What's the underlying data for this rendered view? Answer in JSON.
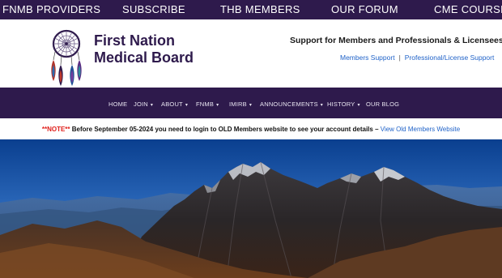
{
  "topbar": {
    "links": [
      "FNMB PROVIDERS",
      "SUBSCRIBE",
      "THB MEMBERS",
      "OUR FORUM",
      "CME COURSES"
    ]
  },
  "header": {
    "logo_line1": "First Nation",
    "logo_line2": "Medical Board",
    "support_title": "Support for Members and Professionals & Licensees",
    "members_support": "Members Support",
    "separator": "|",
    "professional_support": "Professional/License Support"
  },
  "nav": {
    "items": [
      {
        "label": "HOME"
      },
      {
        "label": "JOIN"
      },
      {
        "label": "ABOUT"
      },
      {
        "label": "FNMB"
      },
      {
        "label": "IMIRB"
      },
      {
        "label": "ANNOUNCEMENTS"
      },
      {
        "label": "HISTORY"
      },
      {
        "label": "OUR BLOG"
      }
    ],
    "caret": "▾"
  },
  "notice": {
    "note": "**NOTE**",
    "text": " Before September 05-2024 you need to login to OLD Members website to see your account details – ",
    "link": "View Old Members Website"
  },
  "colors": {
    "brand_purple": "#2e1a4c",
    "link_blue": "#1f62c8",
    "note_red": "#e0201c"
  }
}
